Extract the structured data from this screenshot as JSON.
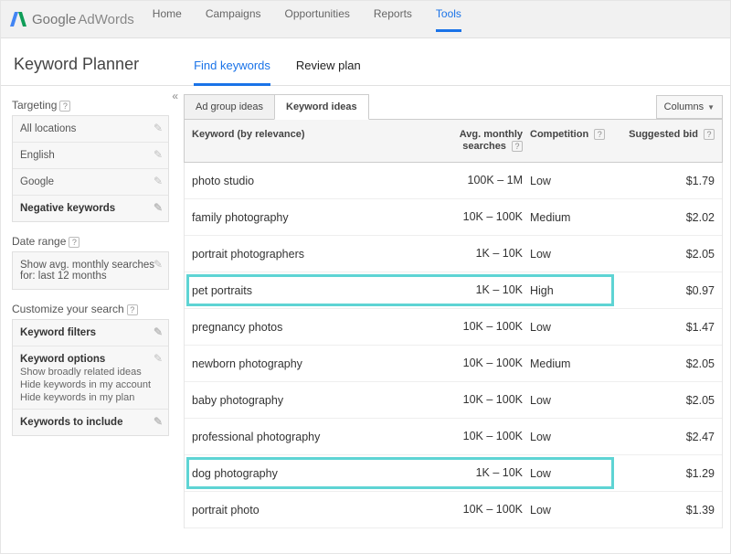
{
  "brand": {
    "google": "Google",
    "product": "AdWords"
  },
  "nav": {
    "items": [
      "Home",
      "Campaigns",
      "Opportunities",
      "Reports",
      "Tools"
    ],
    "active": 4
  },
  "page_title": "Keyword Planner",
  "tabs": {
    "items": [
      "Find keywords",
      "Review plan"
    ],
    "active": 0
  },
  "sidebar": {
    "targeting_label": "Targeting",
    "targeting": [
      "All locations",
      "English",
      "Google",
      "Negative keywords"
    ],
    "date_label": "Date range",
    "date_text": "Show avg. monthly searches for: last 12 months",
    "customize_label": "Customize your search",
    "filters_label": "Keyword filters",
    "options_label": "Keyword options",
    "options": [
      "Show broadly related ideas",
      "Hide keywords in my account",
      "Hide keywords in my plan"
    ],
    "include_label": "Keywords to include"
  },
  "idea_tabs": {
    "items": [
      "Ad group ideas",
      "Keyword ideas"
    ],
    "active": 1
  },
  "columns_btn": "Columns",
  "table": {
    "headers": {
      "kw": "Keyword (by relevance)",
      "search": "Avg. monthly searches",
      "comp": "Competition",
      "bid": "Suggested bid"
    },
    "rows": [
      {
        "kw": "photo studio",
        "search": "100K – 1M",
        "comp": "Low",
        "bid": "$1.79",
        "hl": false
      },
      {
        "kw": "family photography",
        "search": "10K – 100K",
        "comp": "Medium",
        "bid": "$2.02",
        "hl": false
      },
      {
        "kw": "portrait photographers",
        "search": "1K – 10K",
        "comp": "Low",
        "bid": "$2.05",
        "hl": false
      },
      {
        "kw": "pet portraits",
        "search": "1K – 10K",
        "comp": "High",
        "bid": "$0.97",
        "hl": true
      },
      {
        "kw": "pregnancy photos",
        "search": "10K – 100K",
        "comp": "Low",
        "bid": "$1.47",
        "hl": false
      },
      {
        "kw": "newborn photography",
        "search": "10K – 100K",
        "comp": "Medium",
        "bid": "$2.05",
        "hl": false
      },
      {
        "kw": "baby photography",
        "search": "10K – 100K",
        "comp": "Low",
        "bid": "$2.05",
        "hl": false
      },
      {
        "kw": "professional photography",
        "search": "10K – 100K",
        "comp": "Low",
        "bid": "$2.47",
        "hl": false
      },
      {
        "kw": "dog photography",
        "search": "1K – 10K",
        "comp": "Low",
        "bid": "$1.29",
        "hl": true
      },
      {
        "kw": "portrait photo",
        "search": "10K – 100K",
        "comp": "Low",
        "bid": "$1.39",
        "hl": false
      }
    ]
  }
}
